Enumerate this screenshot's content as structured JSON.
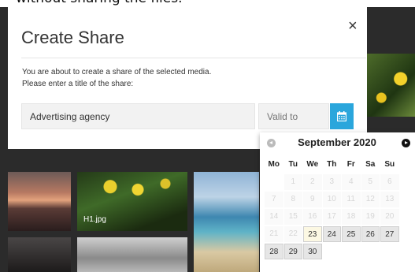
{
  "caption": {
    "text": "without sharing the files."
  },
  "modal": {
    "title": "Create Share",
    "close_label": "×",
    "message_line1": "You are about to create a share of the selected media.",
    "message_line2": "Please enter a title of the share:",
    "title_input_value": "Advertising agency",
    "valid_to_placeholder": "Valid to",
    "calendar_icon": "calendar-icon"
  },
  "gallery": {
    "thumb_label": "H1.jpg"
  },
  "datepicker": {
    "month_label": "September 2020",
    "weekdays": [
      "Mo",
      "Tu",
      "We",
      "Th",
      "Fr",
      "Sa",
      "Su"
    ],
    "days": [
      {
        "label": "",
        "state": "empty"
      },
      {
        "label": "1",
        "state": "disabled"
      },
      {
        "label": "2",
        "state": "disabled"
      },
      {
        "label": "3",
        "state": "disabled"
      },
      {
        "label": "4",
        "state": "disabled"
      },
      {
        "label": "5",
        "state": "disabled"
      },
      {
        "label": "6",
        "state": "disabled"
      },
      {
        "label": "7",
        "state": "disabled"
      },
      {
        "label": "8",
        "state": "disabled"
      },
      {
        "label": "9",
        "state": "disabled"
      },
      {
        "label": "10",
        "state": "disabled"
      },
      {
        "label": "11",
        "state": "disabled"
      },
      {
        "label": "12",
        "state": "disabled"
      },
      {
        "label": "13",
        "state": "disabled"
      },
      {
        "label": "14",
        "state": "disabled"
      },
      {
        "label": "15",
        "state": "disabled"
      },
      {
        "label": "16",
        "state": "disabled"
      },
      {
        "label": "17",
        "state": "disabled"
      },
      {
        "label": "18",
        "state": "disabled"
      },
      {
        "label": "19",
        "state": "disabled"
      },
      {
        "label": "20",
        "state": "disabled"
      },
      {
        "label": "21",
        "state": "disabled"
      },
      {
        "label": "22",
        "state": "disabled"
      },
      {
        "label": "23",
        "state": "today"
      },
      {
        "label": "24",
        "state": "active"
      },
      {
        "label": "25",
        "state": "active"
      },
      {
        "label": "26",
        "state": "active"
      },
      {
        "label": "27",
        "state": "active"
      },
      {
        "label": "28",
        "state": "active"
      },
      {
        "label": "29",
        "state": "active"
      },
      {
        "label": "30",
        "state": "active"
      }
    ]
  }
}
